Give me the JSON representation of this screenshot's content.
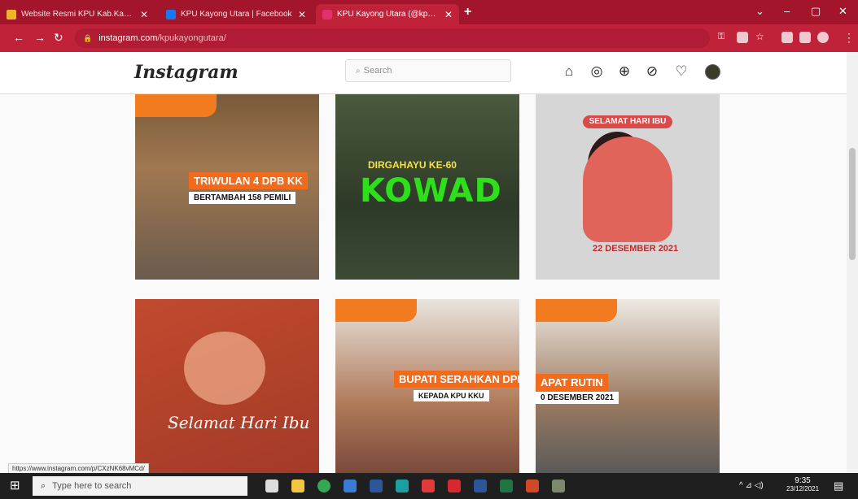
{
  "browser": {
    "tabs": [
      {
        "title": "Website Resmi KPU Kab.Kayong",
        "favicon_color": "#f0b429",
        "active": false
      },
      {
        "title": "KPU Kayong Utara | Facebook",
        "favicon_color": "#1877f2",
        "active": false
      },
      {
        "title": "KPU Kayong Utara (@kpukayon",
        "favicon_color": "#e1306c",
        "active": true
      }
    ],
    "url_host": "instagram.com",
    "url_path": "/kpukayongutara/"
  },
  "instagram": {
    "logo": "Instagram",
    "search_placeholder": "Search"
  },
  "posts": [
    {
      "banner_main": "TRIWULAN 4 DPB KK",
      "banner_sub": "BERTAMBAH 158 PEMILI"
    },
    {
      "header": "DIRGAHAYU KE-60",
      "title": "KOWAD"
    },
    {
      "banner": "SELAMAT HARI IBU",
      "date": "22 DESEMBER 2021"
    },
    {
      "script_text": "Selamat Hari Ibu"
    },
    {
      "banner_main": "BUPATI SERAHKAN DPI",
      "banner_sub": "KEPADA KPU KKU"
    },
    {
      "banner_main": "APAT RUTIN",
      "banner_sub": "0 DESEMBER 2021"
    }
  ],
  "status_url": "https://www.instagram.com/p/CXzNK68vMCd/",
  "taskbar": {
    "search_placeholder": "Type here to search",
    "time": "9:35",
    "date": "23/12/2021"
  },
  "colors": {
    "chrome_dark": "#a3152b",
    "chrome": "#c0223a",
    "kpu_orange": "#f26a1b"
  }
}
